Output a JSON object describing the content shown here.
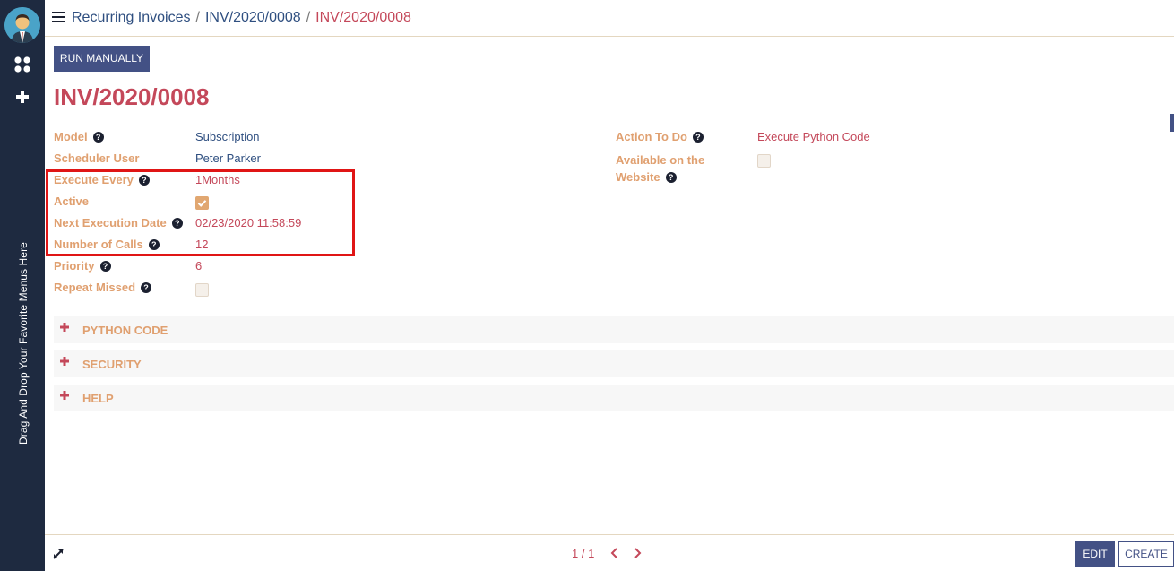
{
  "sidebar": {
    "favorite_hint": "Drag And Drop Your Favorite Menus Here",
    "icons": [
      "avatar",
      "apps-icon",
      "plus-icon"
    ]
  },
  "breadcrumb": {
    "item1": "Recurring Invoices",
    "item2": "INV/2020/0008",
    "current": "INV/2020/0008",
    "separator": "/"
  },
  "toolbar": {
    "run_label": "RUN MANUALLY"
  },
  "record": {
    "title": "INV/2020/0008"
  },
  "left_fields": [
    {
      "label": "Model",
      "value": "Subscription"
    },
    {
      "label": "Scheduler User",
      "value": "Peter Parker"
    },
    {
      "label": "Execute Every",
      "value": "1Months"
    },
    {
      "label": "Active",
      "value": true
    },
    {
      "label": "Next Execution Date",
      "value": "02/23/2020 11:58:59"
    },
    {
      "label": "Number of Calls",
      "value": "12"
    },
    {
      "label": "Priority",
      "value": "6"
    },
    {
      "label": "Repeat Missed",
      "value": false
    }
  ],
  "right_fields": [
    {
      "label": "Action To Do",
      "value": "Execute Python Code"
    },
    {
      "label_line1": "Available on the",
      "label_line2": "Website",
      "value": false
    }
  ],
  "help_glyph": "?",
  "sections": [
    "PYTHON CODE",
    "SECURITY",
    "HELP"
  ],
  "pager": {
    "text": "1 / 1"
  },
  "buttons": {
    "edit": "EDIT",
    "create": "CREATE"
  },
  "colors": {
    "sidebar_bg": "#1e2a40",
    "primary": "#435185",
    "label": "#e0a070",
    "value_red": "#c4485a",
    "value_blue": "#2f4f80",
    "highlight": "#e01515"
  }
}
